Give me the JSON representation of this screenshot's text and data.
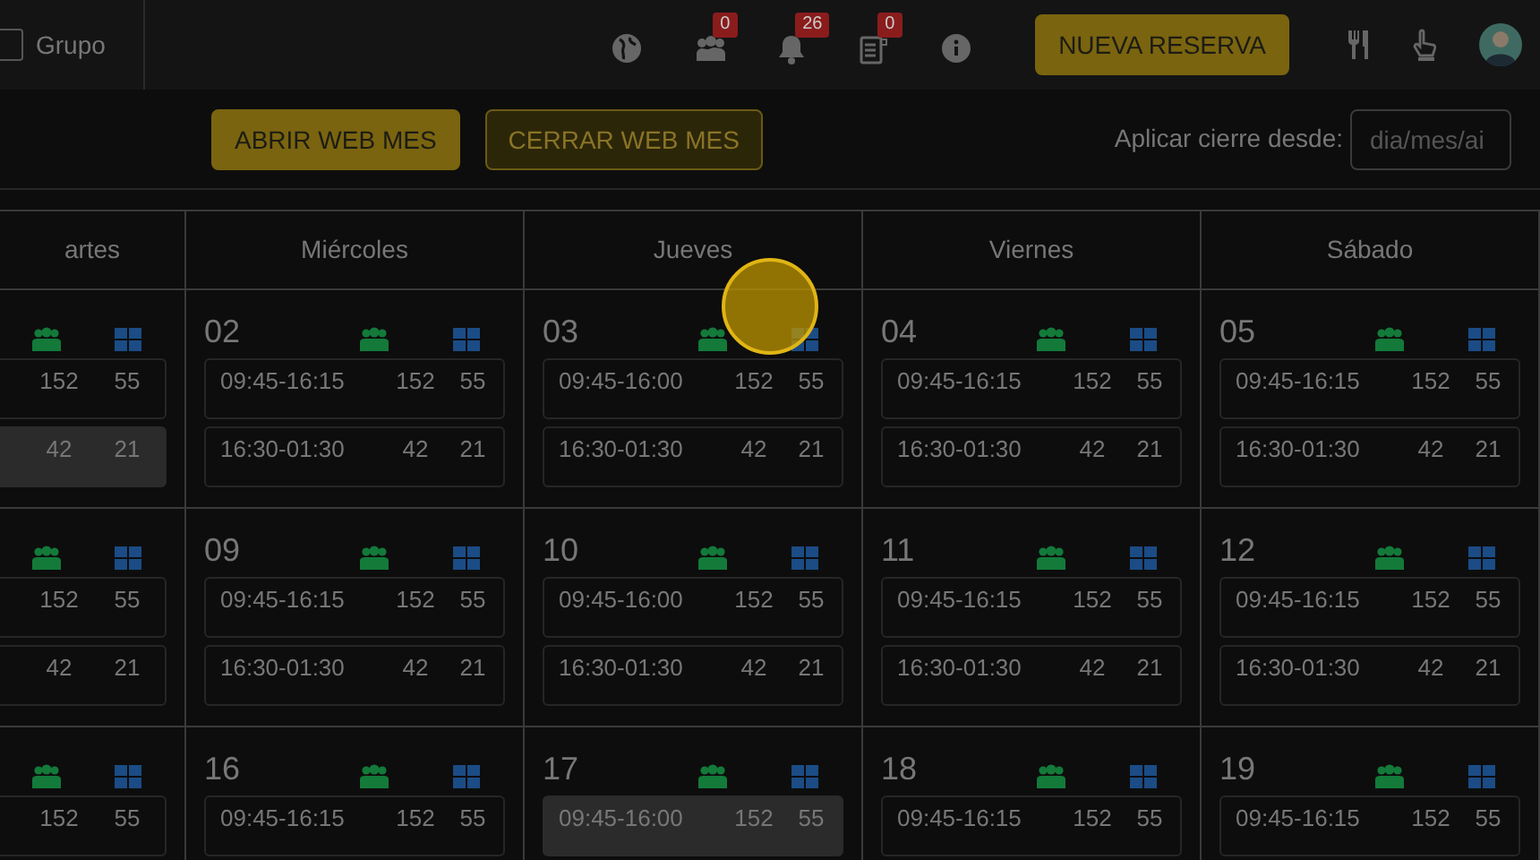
{
  "topbar": {
    "group_checkbox": {
      "label": "Grupo",
      "checked": false
    },
    "notifications": [
      {
        "kind": "globe"
      },
      {
        "kind": "people",
        "badge": "0"
      },
      {
        "kind": "bell",
        "badge": "26"
      },
      {
        "kind": "clipboard",
        "badge": "0"
      },
      {
        "kind": "info"
      }
    ],
    "new_booking_button": "NUEVA RESERVA",
    "tools": [
      {
        "kind": "utensils"
      },
      {
        "kind": "hand"
      },
      {
        "kind": "avatar"
      }
    ]
  },
  "toolbar": {
    "buttons": [
      {
        "label": "ABRIR WEB MES",
        "disabled": false
      },
      {
        "label": "CERRAR WEB MES",
        "disabled": true
      }
    ],
    "close_from_label": "Aplicar cierre desde:",
    "date_field": {
      "placeholder": "dia/mes/ai"
    }
  },
  "calendar": {
    "columns": [
      "artes",
      "Miércoles",
      "Jueves",
      "Viernes",
      "Sábado"
    ],
    "weeks": [
      {
        "cells": [
          {
            "shifts": [
              {
                "covers": "152",
                "tables": "55",
                "selected": false
              },
              {
                "covers": "42",
                "tables": "21",
                "selected": true
              }
            ]
          },
          {
            "day": "02",
            "shifts": [
              {
                "time": "09:45-16:15",
                "covers": "152",
                "tables": "55",
                "selected": false
              },
              {
                "time": "16:30-01:30",
                "covers": "42",
                "tables": "21",
                "selected": false
              }
            ]
          },
          {
            "day": "03",
            "shifts": [
              {
                "time": "09:45-16:00",
                "covers": "152",
                "tables": "55",
                "selected": false
              },
              {
                "time": "16:30-01:30",
                "covers": "42",
                "tables": "21",
                "selected": false
              }
            ]
          },
          {
            "day": "04",
            "shifts": [
              {
                "time": "09:45-16:15",
                "covers": "152",
                "tables": "55",
                "selected": false
              },
              {
                "time": "16:30-01:30",
                "covers": "42",
                "tables": "21",
                "selected": false
              }
            ]
          },
          {
            "day": "05",
            "shifts": [
              {
                "time": "09:45-16:15",
                "covers": "152",
                "tables": "55",
                "selected": false
              },
              {
                "time": "16:30-01:30",
                "covers": "42",
                "tables": "21",
                "selected": false
              }
            ]
          }
        ]
      },
      {
        "cells": [
          {
            "shifts": [
              {
                "covers": "152",
                "tables": "55",
                "selected": false
              },
              {
                "covers": "42",
                "tables": "21",
                "selected": false
              }
            ]
          },
          {
            "day": "09",
            "shifts": [
              {
                "time": "09:45-16:15",
                "covers": "152",
                "tables": "55",
                "selected": false
              },
              {
                "time": "16:30-01:30",
                "covers": "42",
                "tables": "21",
                "selected": false
              }
            ]
          },
          {
            "day": "10",
            "shifts": [
              {
                "time": "09:45-16:00",
                "covers": "152",
                "tables": "55",
                "selected": false
              },
              {
                "time": "16:30-01:30",
                "covers": "42",
                "tables": "21",
                "selected": false
              }
            ]
          },
          {
            "day": "11",
            "shifts": [
              {
                "time": "09:45-16:15",
                "covers": "152",
                "tables": "55",
                "selected": false
              },
              {
                "time": "16:30-01:30",
                "covers": "42",
                "tables": "21",
                "selected": false
              }
            ]
          },
          {
            "day": "12",
            "shifts": [
              {
                "time": "09:45-16:15",
                "covers": "152",
                "tables": "55",
                "selected": false
              },
              {
                "time": "16:30-01:30",
                "covers": "42",
                "tables": "21",
                "selected": false
              }
            ]
          }
        ]
      },
      {
        "cells": [
          {
            "shifts": [
              {
                "covers": "152",
                "tables": "55",
                "selected": false
              }
            ]
          },
          {
            "day": "16",
            "shifts": [
              {
                "time": "09:45-16:15",
                "covers": "152",
                "tables": "55",
                "selected": false
              }
            ]
          },
          {
            "day": "17",
            "shifts": [
              {
                "time": "09:45-16:00",
                "covers": "152",
                "tables": "55",
                "selected": true
              }
            ]
          },
          {
            "day": "18",
            "shifts": [
              {
                "time": "09:45-16:15",
                "covers": "152",
                "tables": "55",
                "selected": false
              }
            ]
          },
          {
            "day": "19",
            "shifts": [
              {
                "time": "09:45-16:15",
                "covers": "152",
                "tables": "55",
                "selected": false
              }
            ]
          }
        ]
      }
    ]
  }
}
